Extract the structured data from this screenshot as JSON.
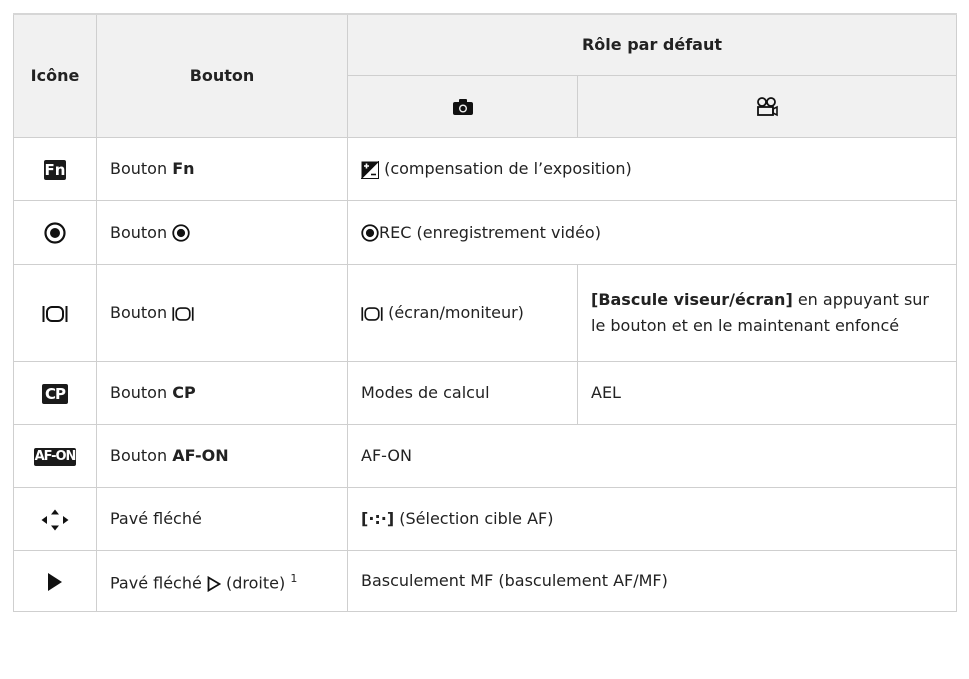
{
  "header": {
    "col_icon": "Icône",
    "col_button": "Bouton",
    "col_role": "Rôle par défaut"
  },
  "icons": {
    "photo_mode": "camera-icon",
    "video_mode": "movie-camera-icon"
  },
  "rows": [
    {
      "icon": "fn-button-icon",
      "icon_text": "Fn",
      "button_prefix": "Bouton ",
      "button_bold": "Fn",
      "role_text": " (compensation de l’exposition)"
    },
    {
      "icon": "record-button-icon",
      "button_prefix": "Bouton ",
      "role_text": "REC (enregistrement vidéo)"
    },
    {
      "icon": "lv-button-icon",
      "button_prefix": "Bouton ",
      "role_photo": " (écran/moniteur)",
      "role_video_bold": "[Bascule viseur/écran]",
      "role_video": " en appuyant sur le bouton et en le maintenant enfoncé"
    },
    {
      "icon": "cp-button-icon",
      "icon_text": "CP",
      "button_prefix": "Bouton ",
      "button_bold": "CP",
      "role_photo": "Modes de calcul",
      "role_video": "AEL"
    },
    {
      "icon": "af-on-button-icon",
      "icon_text": "AF-ON",
      "button_prefix": "Bouton ",
      "button_bold": "AF-ON",
      "role_text": "AF-ON"
    },
    {
      "icon": "arrow-pad-icon",
      "button_label": "Pavé fléché",
      "role_bold": "[·:·]",
      "role_text": " (Sélection cible AF)"
    },
    {
      "icon": "play-right-icon",
      "button_prefix": "Pavé fléché ",
      "button_suffix": " (droite) ",
      "button_sup": "1",
      "role_text": "Basculement MF (basculement AF/MF)"
    }
  ]
}
